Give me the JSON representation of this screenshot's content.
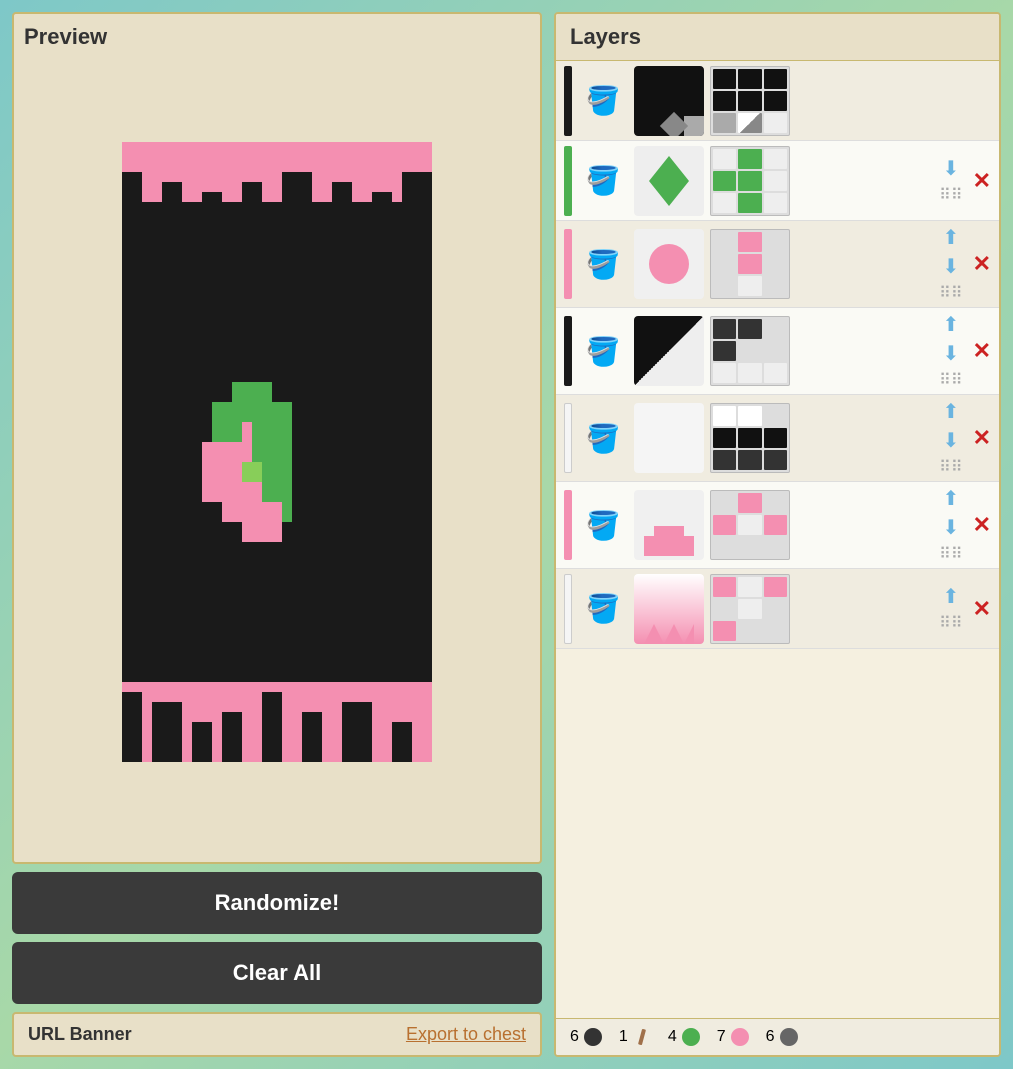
{
  "left_panel": {
    "preview_title": "Preview",
    "randomize_label": "Randomize!",
    "clear_all_label": "Clear All",
    "url_label": "URL Banner",
    "export_label": "Export to chest"
  },
  "right_panel": {
    "layers_title": "Layers",
    "layers": [
      {
        "id": 0,
        "stripe_color": "#1a1a1a",
        "icon": "🪣",
        "pattern_desc": "base_black",
        "grid_colors": [
          "#111",
          "#111",
          "#111",
          "#111",
          "#111",
          "#111",
          "#aaa",
          "#aaa",
          "#ccc"
        ],
        "controls": {
          "up": false,
          "down": false
        }
      },
      {
        "id": 1,
        "stripe_color": "#4caf50",
        "icon": "🪣",
        "pattern_desc": "diamond_green",
        "grid_colors": [
          "#fff",
          "#4caf50",
          "#fff",
          "#4caf50",
          "#4caf50",
          "#fff",
          "#fff",
          "#4caf50",
          "#fff"
        ],
        "controls": {
          "up": false,
          "down": true
        }
      },
      {
        "id": 2,
        "stripe_color": "#f48fb1",
        "icon": "🪣",
        "pattern_desc": "circle_pink",
        "grid_colors": [
          "#ddd",
          "#f48fb1",
          "#ddd",
          "#ddd",
          "#f48fb1",
          "#ddd",
          "#ddd",
          "#eee",
          "#ddd"
        ],
        "controls": {
          "up": true,
          "down": true
        }
      },
      {
        "id": 3,
        "stripe_color": "#1a1a1a",
        "icon": "🪣",
        "pattern_desc": "diagonal_black",
        "grid_colors": [
          "#111",
          "#111",
          "#ddd",
          "#111",
          "#ddd",
          "#ddd",
          "#eee",
          "#eee",
          "#eee"
        ],
        "controls": {
          "up": true,
          "down": true
        }
      },
      {
        "id": 4,
        "stripe_color": "#f5f5f5",
        "icon": "🪣",
        "pattern_desc": "stripe_white",
        "grid_colors": [
          "#fff",
          "#fff",
          "#ddd",
          "#111",
          "#111",
          "#111",
          "#111",
          "#111",
          "#111"
        ],
        "controls": {
          "up": true,
          "down": true
        }
      },
      {
        "id": 5,
        "stripe_color": "#f48fb1",
        "icon": "🪣",
        "pattern_desc": "creeper_pink",
        "grid_colors": [
          "#ddd",
          "#f48fb1",
          "#ddd",
          "#f48fb1",
          "#eee",
          "#f48fb1",
          "#ddd",
          "#ddd",
          "#ddd"
        ],
        "controls": {
          "up": true,
          "down": true
        }
      },
      {
        "id": 6,
        "stripe_color": "#f5f5f5",
        "icon": "🪣",
        "pattern_desc": "gradient_white",
        "grid_colors": [
          "#f48fb1",
          "#eee",
          "#f48fb1",
          "#ddd",
          "#eee",
          "#ddd",
          "#f48fb1",
          "#ddd",
          "#ddd"
        ],
        "controls": {
          "up": true,
          "down": false
        }
      }
    ]
  },
  "materials": [
    {
      "count": "6",
      "color": "#333",
      "shape": "circle"
    },
    {
      "count": "1",
      "color": "#aaa",
      "shape": "stick"
    },
    {
      "count": "4",
      "color": "#4caf50",
      "shape": "circle"
    },
    {
      "count": "7",
      "color": "#f48fb1",
      "shape": "circle"
    },
    {
      "count": "6",
      "color": "#555",
      "shape": "circle"
    }
  ]
}
